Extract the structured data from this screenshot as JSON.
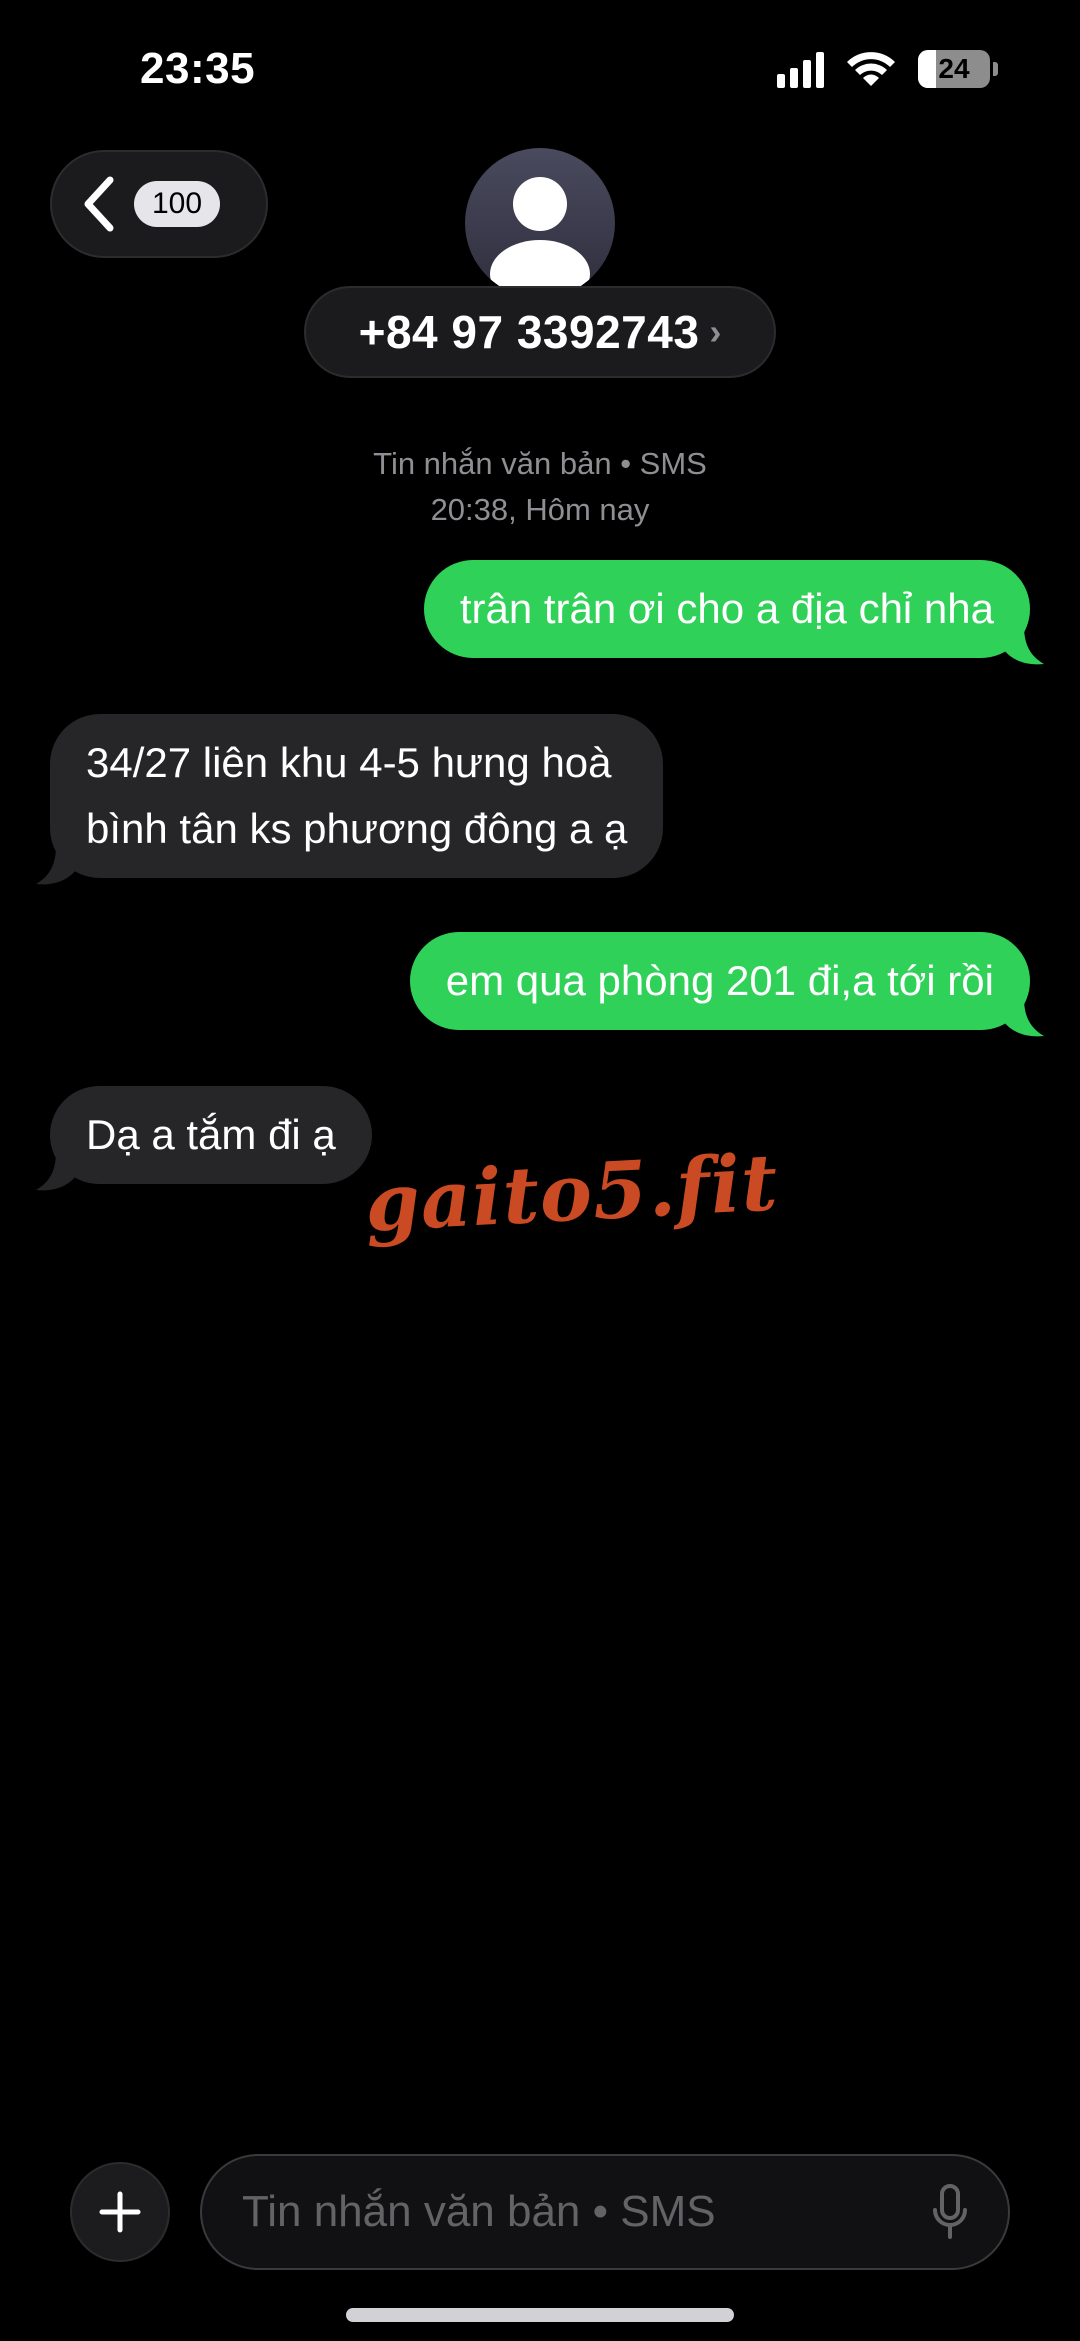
{
  "status_bar": {
    "time": "23:35",
    "battery": "24"
  },
  "header": {
    "back_badge": "100",
    "contact": "+84 97 3392743",
    "chevron": "›"
  },
  "thread_meta": {
    "channel": "Tin nhắn văn bản • SMS",
    "timestamp": "20:38, Hôm nay"
  },
  "messages": [
    {
      "direction": "outgoing",
      "text": "trân trân ơi cho a địa chỉ nha"
    },
    {
      "direction": "incoming",
      "line1": "34/27 liên khu 4-5 hưng hoà",
      "line2": "bình tân ks phương đông a ạ"
    },
    {
      "direction": "outgoing",
      "text": "em qua phòng 201 đi,a tới rồi"
    },
    {
      "direction": "incoming",
      "text": "Dạ a tắm đi ạ"
    }
  ],
  "watermark": "gaito5.fit",
  "composer": {
    "placeholder": "Tin nhắn văn bản • SMS"
  },
  "colors": {
    "outgoing_bubble": "#30d158",
    "incoming_bubble": "#262628",
    "background": "#000000",
    "watermark": "#c94a23"
  },
  "icons": [
    "back-chevron-icon",
    "signal-icon",
    "wifi-icon",
    "battery-icon",
    "contact-avatar-icon",
    "plus-icon",
    "microphone-icon"
  ]
}
